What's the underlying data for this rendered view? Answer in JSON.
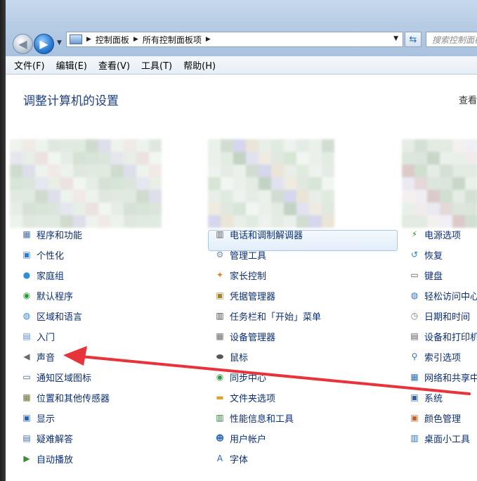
{
  "address": {
    "crumbs": [
      "控制面板",
      "所有控制面板项"
    ],
    "search_placeholder": "搜索控制面板"
  },
  "menu": [
    "文件(F)",
    "编辑(E)",
    "查看(V)",
    "工具(T)",
    "帮助(H)"
  ],
  "page": {
    "title": "调整计算机的设置",
    "view_by": "查看"
  },
  "columns": [
    {
      "items": [
        {
          "label": "程序和功能",
          "icon": "programs-icon",
          "color": "#4a6fa5",
          "glyph": "▦"
        },
        {
          "label": "个性化",
          "icon": "personalization-icon",
          "color": "#2d7ad6",
          "glyph": "▣"
        },
        {
          "label": "家庭组",
          "icon": "homegroup-icon",
          "color": "#2f8fd1",
          "glyph": "●"
        },
        {
          "label": "默认程序",
          "icon": "default-programs-icon",
          "color": "#2c9c3a",
          "glyph": "◉"
        },
        {
          "label": "区域和语言",
          "icon": "globe-icon",
          "color": "#3a83c9",
          "glyph": "◍"
        },
        {
          "label": "入门",
          "icon": "getting-started-icon",
          "color": "#5a8fd1",
          "glyph": "▤"
        },
        {
          "label": "声音",
          "icon": "speaker-icon",
          "color": "#6b6b6b",
          "glyph": "◀"
        },
        {
          "label": "通知区域图标",
          "icon": "notification-icon",
          "color": "#3b5f91",
          "glyph": "▭"
        },
        {
          "label": "位置和其他传感器",
          "icon": "sensor-icon",
          "color": "#6e6e3b",
          "glyph": "▦"
        },
        {
          "label": "显示",
          "icon": "display-icon",
          "color": "#2a62b4",
          "glyph": "▣"
        },
        {
          "label": "疑难解答",
          "icon": "troubleshoot-icon",
          "color": "#3d6fb2",
          "glyph": "▤"
        },
        {
          "label": "自动播放",
          "icon": "autoplay-icon",
          "color": "#3a8c3a",
          "glyph": "▶"
        }
      ]
    },
    {
      "items": [
        {
          "label": "电话和调制解调器",
          "icon": "phone-modem-icon",
          "color": "#5b5b5b",
          "glyph": "▥"
        },
        {
          "label": "管理工具",
          "icon": "admin-tools-icon",
          "color": "#7a8ea8",
          "glyph": "⚙"
        },
        {
          "label": "家长控制",
          "icon": "parental-control-icon",
          "color": "#d18a2f",
          "glyph": "✦"
        },
        {
          "label": "凭据管理器",
          "icon": "credential-icon",
          "color": "#a0822d",
          "glyph": "▣"
        },
        {
          "label": "任务栏和「开始」菜单",
          "icon": "taskbar-icon",
          "color": "#4a4a4a",
          "glyph": "▥"
        },
        {
          "label": "设备管理器",
          "icon": "device-manager-icon",
          "color": "#6b6b6b",
          "glyph": "▦"
        },
        {
          "label": "鼠标",
          "icon": "mouse-icon",
          "color": "#555555",
          "glyph": "⬬"
        },
        {
          "label": "同步中心",
          "icon": "sync-icon",
          "color": "#2f9c42",
          "glyph": "◉"
        },
        {
          "label": "文件夹选项",
          "icon": "folder-icon",
          "color": "#d6a530",
          "glyph": "▬"
        },
        {
          "label": "性能信息和工具",
          "icon": "performance-icon",
          "color": "#2f7a3a",
          "glyph": "▥"
        },
        {
          "label": "用户帐户",
          "icon": "user-accounts-icon",
          "color": "#3f73b8",
          "glyph": "☻"
        },
        {
          "label": "字体",
          "icon": "font-icon",
          "color": "#2a62c4",
          "glyph": "A"
        }
      ]
    },
    {
      "items": [
        {
          "label": "电源选项",
          "icon": "power-icon",
          "color": "#3b8f3b",
          "glyph": "⚡"
        },
        {
          "label": "恢复",
          "icon": "recovery-icon",
          "color": "#2e7fb8",
          "glyph": "↺"
        },
        {
          "label": "键盘",
          "icon": "keyboard-icon",
          "color": "#555555",
          "glyph": "▭"
        },
        {
          "label": "轻松访问中心",
          "icon": "ease-access-icon",
          "color": "#2d6fc4",
          "glyph": "◍"
        },
        {
          "label": "日期和时间",
          "icon": "clock-icon",
          "color": "#7a7a7a",
          "glyph": "◷"
        },
        {
          "label": "设备和打印机",
          "icon": "printer-icon",
          "color": "#5a5a5a",
          "glyph": "▤"
        },
        {
          "label": "索引选项",
          "icon": "indexing-icon",
          "color": "#3a6fb2",
          "glyph": "⚲"
        },
        {
          "label": "网络和共享中心",
          "icon": "network-icon",
          "color": "#2f6fb0",
          "glyph": "▦"
        },
        {
          "label": "系统",
          "icon": "system-icon",
          "color": "#2d5fa8",
          "glyph": "▣"
        },
        {
          "label": "颜色管理",
          "icon": "color-mgmt-icon",
          "color": "#c7602d",
          "glyph": "▣"
        },
        {
          "label": "桌面小工具",
          "icon": "gadgets-icon",
          "color": "#2d6fc4",
          "glyph": "▥"
        }
      ]
    }
  ]
}
